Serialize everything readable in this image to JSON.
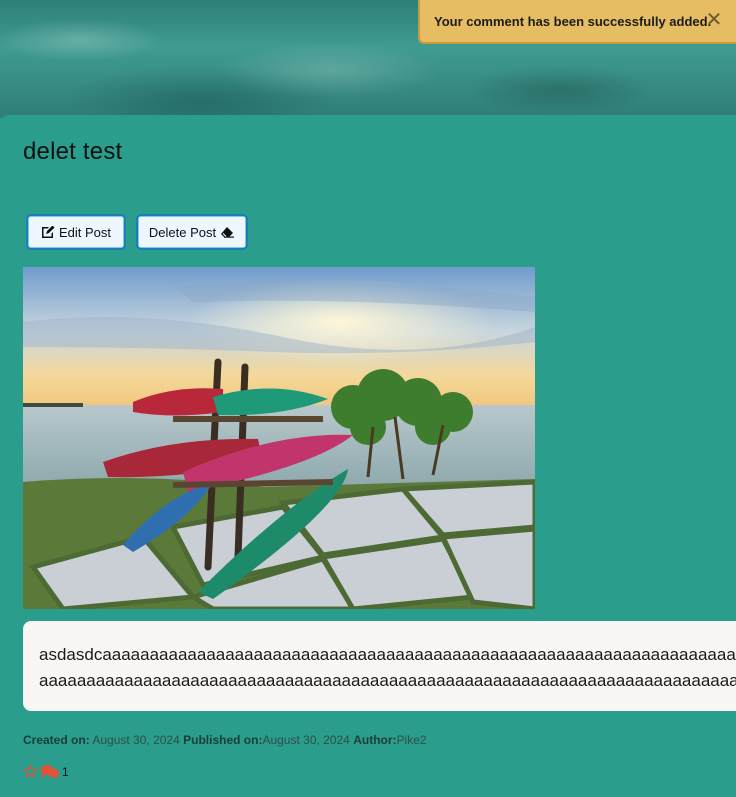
{
  "toast": {
    "message": "Your comment has been successfully added.",
    "close_icon": "close-icon"
  },
  "post": {
    "title": "delet test",
    "content_line1": "asdasdcaaaaaaaaaaaaaaaaaaaaaaaaaaaaaaaaaaaaaaaaaaaaaaaaaaaaaaaaaaaaaaaaaaaaaaaaaaaaaa",
    "content_line2": "aaaaaaaaaaaaaaaaaaaaaaaaaaaaaaaaaaaaaaaaaaaaaaaaaaaaaaaaaaaaaaaaaaaaaaaaaaaaaaaaaaaaaaa",
    "image_alt": "Kayaks on a rack at a seaside terrace at sunset"
  },
  "actions": {
    "edit_label": "Edit Post",
    "edit_icon": "pen-to-square-icon",
    "delete_label": "Delete Post",
    "delete_icon": "eraser-icon"
  },
  "meta": {
    "created_label": "Created on:",
    "created_value": "August 30, 2024",
    "published_label": "Published on:",
    "published_value": "August 30, 2024",
    "author_label": "Author:",
    "author_value": "Pike2"
  },
  "stats": {
    "like_icon": "star-outline-icon",
    "comment_icon": "comments-icon",
    "comment_count": "1",
    "icon_color": "#e0533b"
  },
  "colors": {
    "background": "#2a9d8c",
    "toast": "#e6bd63",
    "button_border": "#1a7fb8"
  }
}
